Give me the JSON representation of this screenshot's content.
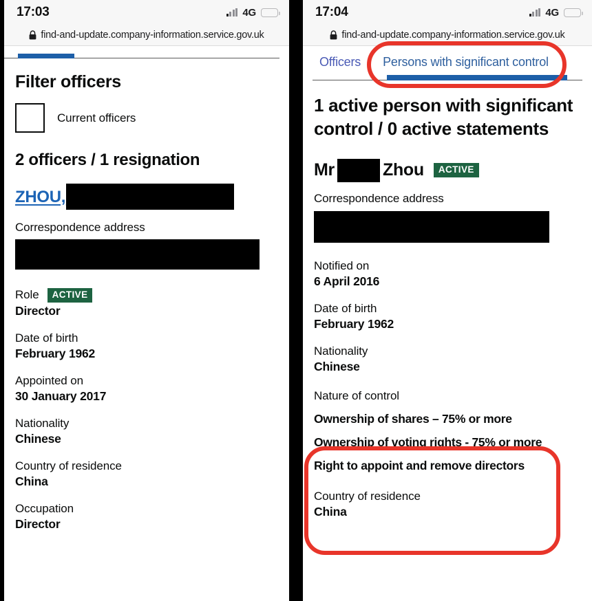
{
  "left": {
    "status": {
      "time": "17:03",
      "network": "4G",
      "signal_icon": "signal-bars-icon",
      "battery_icon": "battery-low-icon"
    },
    "url": {
      "lock_icon": "lock-icon",
      "domain": "find-and-update.company-information.service.gov.uk"
    },
    "page_title": "Filter officers",
    "filter": {
      "checkbox_label": "Current officers",
      "checked": false
    },
    "count_title": "2 officers / 1 resignation",
    "officer": {
      "surname_link": "ZHOU,",
      "name_redacted": true,
      "address_label": "Correspondence address",
      "address_redacted": true,
      "role_label": "Role",
      "role_badge": "ACTIVE",
      "role_value": "Director",
      "fields": [
        {
          "label": "Date of birth",
          "value": "February 1962"
        },
        {
          "label": "Appointed on",
          "value": "30 January 2017"
        },
        {
          "label": "Nationality",
          "value": "Chinese"
        },
        {
          "label": "Country of residence",
          "value": "China"
        },
        {
          "label": "Occupation",
          "value": "Director"
        }
      ]
    }
  },
  "right": {
    "status": {
      "time": "17:04",
      "network": "4G",
      "signal_icon": "signal-bars-icon",
      "battery_icon": "battery-low-icon"
    },
    "url": {
      "lock_icon": "lock-icon",
      "domain": "find-and-update.company-information.service.gov.uk"
    },
    "tabs": [
      {
        "label": "Officers",
        "active": false
      },
      {
        "label": "Persons with significant control",
        "active": true
      }
    ],
    "psc_title": "1 active person with significant control / 0 active statements",
    "person": {
      "name_prefix": "Mr",
      "name_redacted": true,
      "surname": "Zhou",
      "badge": "ACTIVE",
      "address_label": "Correspondence address",
      "address_redacted": true,
      "fields_top": [
        {
          "label": "Notified on",
          "value": "6 April 2016"
        },
        {
          "label": "Date of birth",
          "value": "February 1962"
        },
        {
          "label": "Nationality",
          "value": "Chinese"
        }
      ],
      "nature_of_control": {
        "label": "Nature of control",
        "items": [
          "Ownership of shares – 75% or more",
          "Ownership of voting rights - 75% or more",
          "Right to appoint and remove directors"
        ]
      },
      "fields_bottom": [
        {
          "label": "Country of residence",
          "value": "China"
        }
      ]
    }
  },
  "annotations": {
    "color": "#e8352a",
    "items": [
      {
        "name": "highlight-psc-tab"
      },
      {
        "name": "highlight-nature-of-control"
      }
    ]
  },
  "colors": {
    "link": "#1d64b5",
    "tab_active": "#2e5f9e",
    "tab_inactive": "#4a5ab5",
    "badge_green": "#1d6341",
    "indicator_blue": "#1d5fa8",
    "annotation_red": "#e8352a",
    "battery_yellow": "#f5cc3d"
  }
}
